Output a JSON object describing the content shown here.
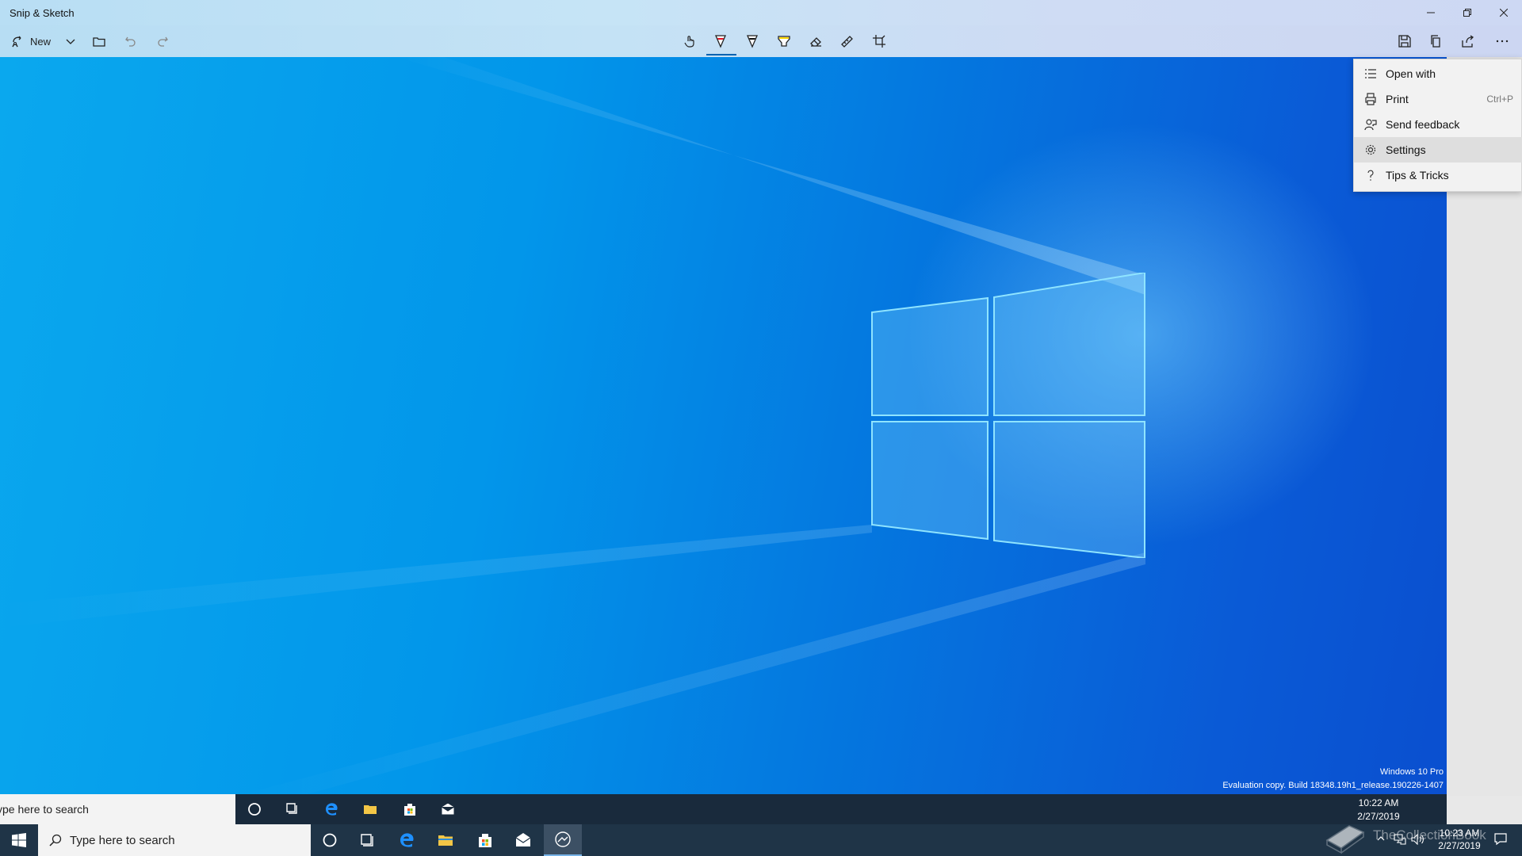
{
  "window": {
    "title": "Snip & Sketch",
    "minimize_icon": "minimize-icon",
    "maximize_icon": "restore-icon",
    "close_icon": "close-icon"
  },
  "toolbar": {
    "new_label": "New",
    "tools": [
      "touch-writing",
      "ballpoint-pen",
      "pencil",
      "highlighter",
      "eraser",
      "ruler",
      "crop"
    ],
    "selected_tool": "ballpoint-pen",
    "accent": "#0063b1"
  },
  "menu": {
    "items": [
      {
        "label": "Open with",
        "icon": "open-with-icon",
        "shortcut": ""
      },
      {
        "label": "Print",
        "icon": "print-icon",
        "shortcut": "Ctrl+P"
      },
      {
        "label": "Send feedback",
        "icon": "feedback-icon",
        "shortcut": ""
      },
      {
        "label": "Settings",
        "icon": "gear-icon",
        "shortcut": ""
      },
      {
        "label": "Tips & Tricks",
        "icon": "question-icon",
        "shortcut": ""
      }
    ],
    "highlighted": "Settings"
  },
  "canvas": {
    "watermark_line1": "Windows 10 Pro",
    "watermark_line2": "Evaluation copy. Build 18348.19h1_release.190226-1407",
    "captured_search": "ype here to search",
    "captured_time": "10:22 AM",
    "captured_date": "2/27/2019"
  },
  "taskbar": {
    "search_placeholder": "Type here to search",
    "time": "10:23 AM",
    "date": "2/27/2019",
    "watermark_text": "TheCollectionBook"
  }
}
